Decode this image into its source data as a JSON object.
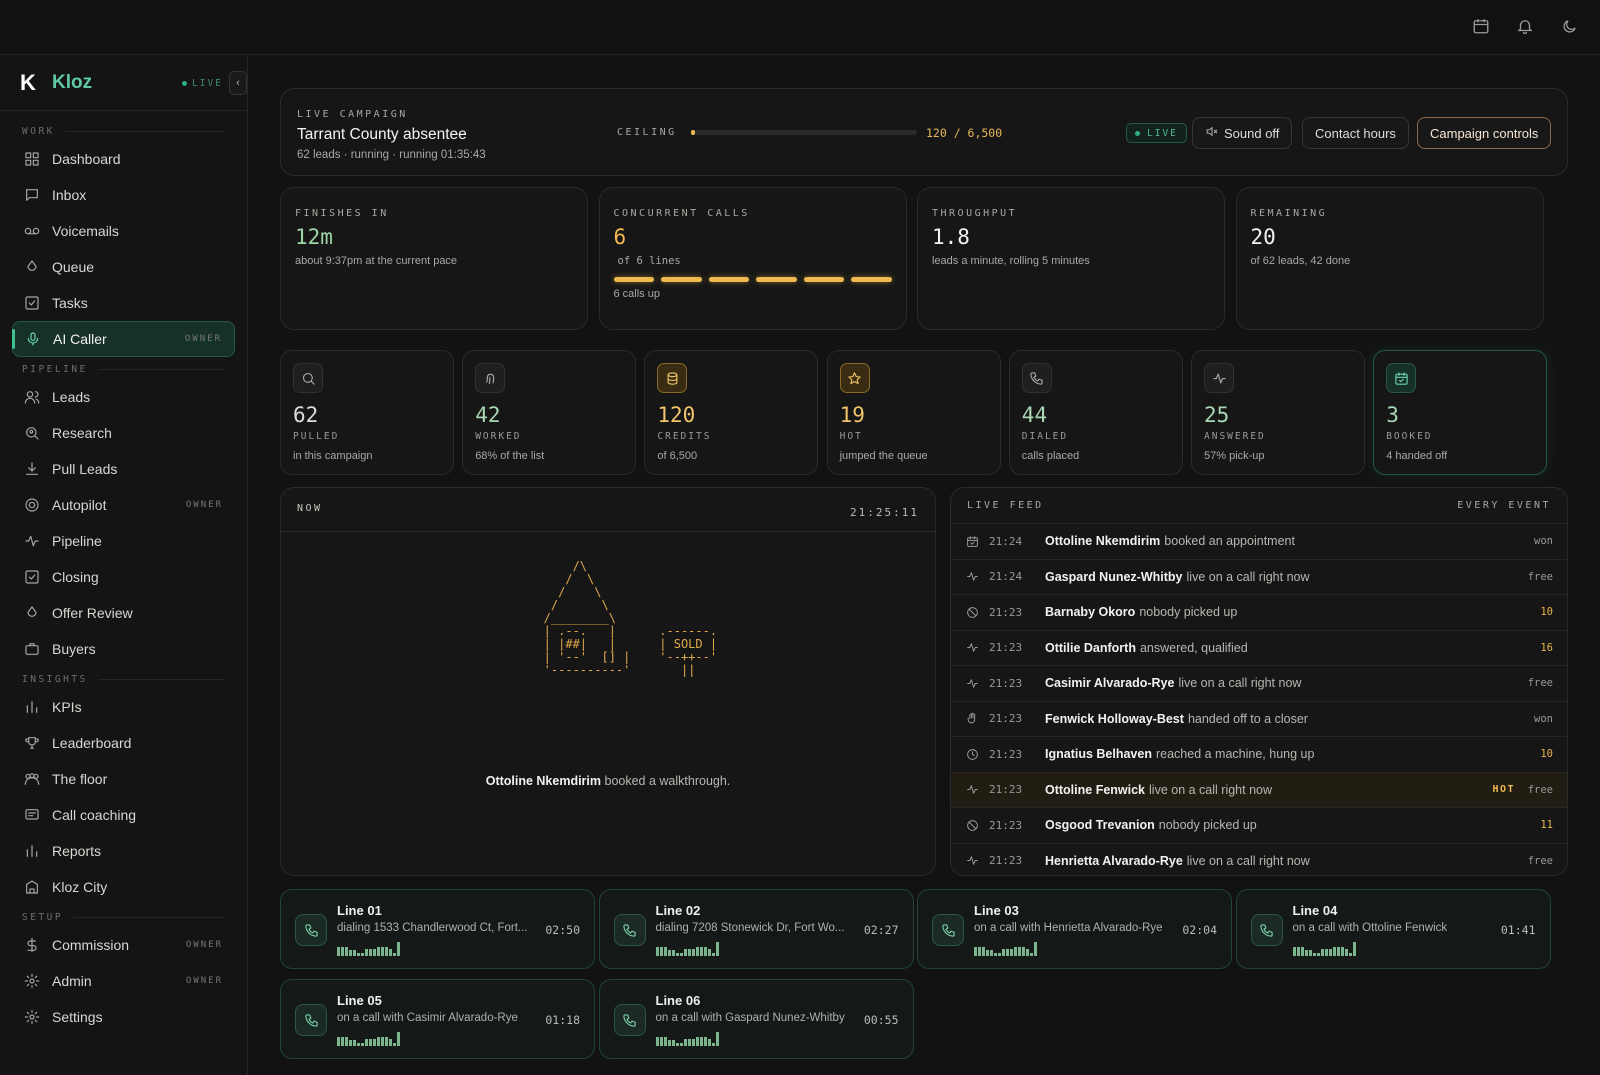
{
  "app": {
    "name": "Kloz",
    "live_label": "LIVE",
    "collapse": "‹"
  },
  "sidebar": {
    "sections": [
      {
        "label": "WORK",
        "items": [
          {
            "label": "Dashboard",
            "icon": "grid-icon"
          },
          {
            "label": "Inbox",
            "icon": "chat-icon"
          },
          {
            "label": "Voicemails",
            "icon": "voicemail-icon"
          },
          {
            "label": "Queue",
            "icon": "drop-icon"
          },
          {
            "label": "Tasks",
            "icon": "check-square-icon"
          },
          {
            "label": "AI Caller",
            "icon": "mic-icon",
            "badge": "OWNER",
            "active": true
          }
        ]
      },
      {
        "label": "PIPELINE",
        "items": [
          {
            "label": "Leads",
            "icon": "users-icon"
          },
          {
            "label": "Research",
            "icon": "search-user-icon"
          },
          {
            "label": "Pull Leads",
            "icon": "download-icon"
          },
          {
            "label": "Autopilot",
            "icon": "target-icon",
            "badge": "OWNER"
          },
          {
            "label": "Pipeline",
            "icon": "pulse-icon"
          },
          {
            "label": "Closing",
            "icon": "check-square-icon"
          },
          {
            "label": "Offer Review",
            "icon": "drop-icon"
          },
          {
            "label": "Buyers",
            "icon": "briefcase-icon"
          }
        ]
      },
      {
        "label": "INSIGHTS",
        "items": [
          {
            "label": "KPIs",
            "icon": "bar-chart-icon"
          },
          {
            "label": "Leaderboard",
            "icon": "trophy-icon"
          },
          {
            "label": "The floor",
            "icon": "team-icon"
          },
          {
            "label": "Call coaching",
            "icon": "message-icon"
          },
          {
            "label": "Reports",
            "icon": "bar-chart-icon"
          },
          {
            "label": "Kloz City",
            "icon": "building-icon"
          }
        ]
      },
      {
        "label": "SETUP",
        "items": [
          {
            "label": "Commission",
            "icon": "dollar-icon",
            "badge": "OWNER"
          },
          {
            "label": "Admin",
            "icon": "gear-icon",
            "badge": "OWNER"
          },
          {
            "label": "Settings",
            "icon": "gear-icon"
          }
        ]
      }
    ]
  },
  "campaign": {
    "eyebrow": "LIVE CAMPAIGN",
    "name": "Tarrant County absentee",
    "meta": "62 leads · running · running 01:35:43",
    "ceiling_label": "CEILING",
    "ceiling_value": "120 / 6,500",
    "ceiling_fraction": 0.018,
    "live_badge": "LIVE",
    "sound_btn": "Sound off",
    "hours_btn": "Contact hours",
    "controls_btn": "Campaign controls"
  },
  "stats": [
    {
      "label": "FINISHES IN",
      "value": "12m",
      "sub": "about 9:37pm at the current pace",
      "color": "#9fd6a6"
    },
    {
      "label": "CONCURRENT CALLS",
      "value": "6",
      "sub": "of 6 lines",
      "sub2": "6 calls up",
      "color": "#f0b94f",
      "active_lines": 6
    },
    {
      "label": "THROUGHPUT",
      "value": "1.8",
      "sub": "leads a minute, rolling 5 minutes",
      "color": "#f2f2f2"
    },
    {
      "label": "REMAINING",
      "value": "20",
      "sub": "of 62 leads, 42 done",
      "color": "#f2f2f2"
    }
  ],
  "tiles": [
    {
      "value": "62",
      "label": "PULLED",
      "sub": "in this campaign",
      "icon": "search-icon",
      "color": "#dcdcdc"
    },
    {
      "value": "42",
      "label": "WORKED",
      "sub": "68% of the list",
      "icon": "fingerprint-icon",
      "color": "#a9d7b3"
    },
    {
      "value": "120",
      "label": "CREDITS",
      "sub": "of 6,500",
      "icon": "database-icon",
      "color": "#f0c56a",
      "accent": "amber"
    },
    {
      "value": "19",
      "label": "HOT",
      "sub": "jumped the queue",
      "icon": "star-icon",
      "color": "#f0c56a",
      "accent": "amber"
    },
    {
      "value": "44",
      "label": "DIALED",
      "sub": "calls placed",
      "icon": "phone-icon",
      "color": "#a9d7b3"
    },
    {
      "value": "25",
      "label": "ANSWERED",
      "sub": "57% pick-up",
      "icon": "pulse-icon",
      "color": "#a9d7b3"
    },
    {
      "value": "3",
      "label": "BOOKED",
      "sub": "4 handed off",
      "icon": "calendar-icon",
      "color": "#a9d7b3",
      "accent": "green"
    }
  ],
  "now": {
    "label": "NOW",
    "clock": "21:25:11",
    "art": "       /\\\n      /  \\\n     /    \\\n    /      \\\n   /________\\\n   | .--.   |      .------.\n   | |##|   |      | SOLD |\n   | '--'  [] |    '--++--'\n   '----------'       ||",
    "caption_name": "Ottoline Nkemdirim",
    "caption_action": "booked a walkthrough."
  },
  "feed": {
    "label": "LIVE FEED",
    "filter": "EVERY EVENT",
    "rows": [
      {
        "icon": "calendar-icon",
        "time": "21:24",
        "name": "Ottoline Nkemdirim",
        "action": "booked an appointment",
        "value": "won"
      },
      {
        "icon": "pulse-icon",
        "time": "21:24",
        "name": "Gaspard Nunez-Whitby",
        "action": "live on a call right now",
        "value": "free"
      },
      {
        "icon": "no-answer-icon",
        "time": "21:23",
        "name": "Barnaby Okoro",
        "action": "nobody picked up",
        "value": "10",
        "num": true
      },
      {
        "icon": "pulse-icon",
        "time": "21:23",
        "name": "Ottilie Danforth",
        "action": "answered, qualified",
        "value": "16",
        "num": true
      },
      {
        "icon": "pulse-icon",
        "time": "21:23",
        "name": "Casimir Alvarado-Rye",
        "action": "live on a call right now",
        "value": "free"
      },
      {
        "icon": "hand-icon",
        "time": "21:23",
        "name": "Fenwick Holloway-Best",
        "action": "handed off to a closer",
        "value": "won"
      },
      {
        "icon": "clock-icon",
        "time": "21:23",
        "name": "Ignatius Belhaven",
        "action": "reached a machine, hung up",
        "value": "10",
        "num": true
      },
      {
        "icon": "pulse-icon",
        "time": "21:23",
        "name": "Ottoline Fenwick",
        "action": "live on a call right now",
        "value": "free",
        "tag": "HOT",
        "highlight": true
      },
      {
        "icon": "no-answer-icon",
        "time": "21:23",
        "name": "Osgood Trevanion",
        "action": "nobody picked up",
        "value": "11",
        "num": true
      },
      {
        "icon": "pulse-icon",
        "time": "21:23",
        "name": "Henrietta Alvarado-Rye",
        "action": "live on a call right now",
        "value": "free"
      }
    ]
  },
  "lines": [
    {
      "name": "Line 01",
      "status": "dialing 1533 Chandlerwood Ct, Fort...",
      "time": "02:50"
    },
    {
      "name": "Line 02",
      "status": "dialing 7208 Stonewick Dr, Fort Wo...",
      "time": "02:27"
    },
    {
      "name": "Line 03",
      "status": "on a call with Henrietta Alvarado-Rye",
      "time": "02:04"
    },
    {
      "name": "Line 04",
      "status": "on a call with Ottoline Fenwick",
      "time": "01:41"
    },
    {
      "name": "Line 05",
      "status": "on a call with Casimir Alvarado-Rye",
      "time": "01:18"
    },
    {
      "name": "Line 06",
      "status": "on a call with Gaspard Nunez-Whitby",
      "time": "00:55"
    }
  ]
}
